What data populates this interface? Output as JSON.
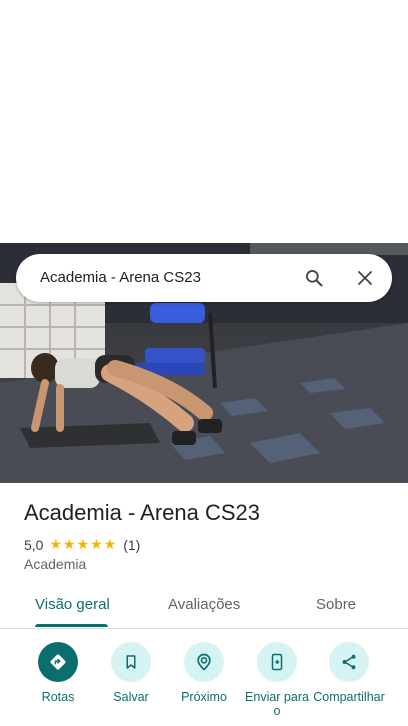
{
  "search": {
    "query": "Academia - Arena CS23"
  },
  "place": {
    "title": "Academia - Arena CS23",
    "rating": "5,0",
    "stars": "★★★★★",
    "review_count": "(1)",
    "category": "Academia"
  },
  "tabs": [
    {
      "label": "Visão geral",
      "active": true
    },
    {
      "label": "Avaliações",
      "active": false
    },
    {
      "label": "Sobre",
      "active": false
    }
  ],
  "actions": [
    {
      "label": "Rotas",
      "icon": "directions-icon"
    },
    {
      "label": "Salvar",
      "icon": "bookmark-icon"
    },
    {
      "label": "Próximo",
      "icon": "nearby-icon"
    },
    {
      "label": "Enviar para o",
      "icon": "send-to-phone-icon"
    },
    {
      "label": "Compartilhar",
      "icon": "share-icon"
    }
  ],
  "colors": {
    "accent": "#0b6e6e",
    "action_bg": "#d6f3f3",
    "star": "#f6b400"
  }
}
